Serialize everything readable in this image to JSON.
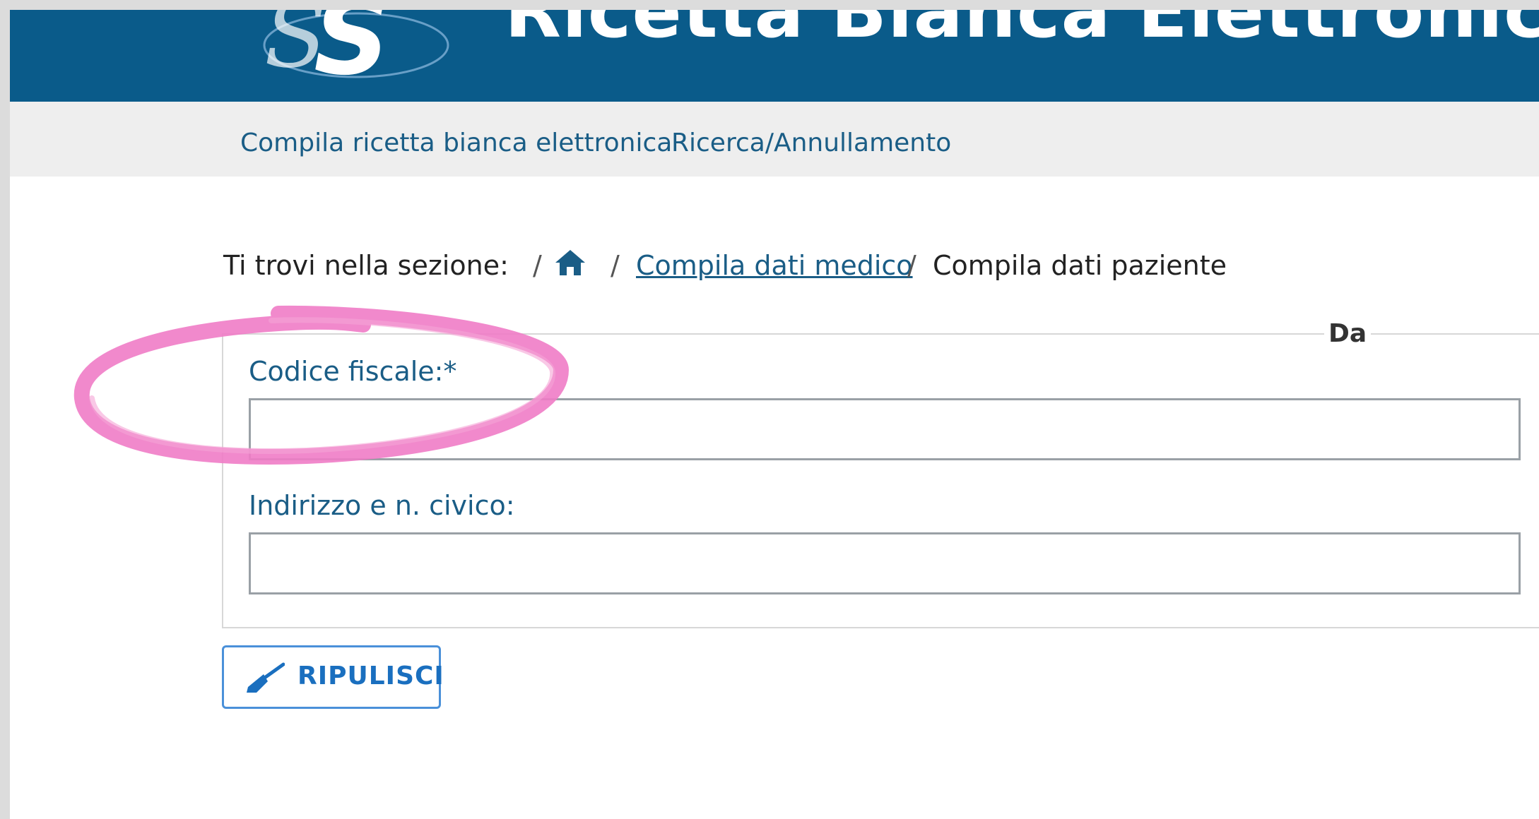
{
  "header": {
    "title": "Ricetta Bianca Elettronica",
    "logo_icon": "sts-logo-icon",
    "background_color": "#0a5b8a"
  },
  "nav": {
    "items": [
      {
        "label": "Compila ricetta bianca elettronica"
      },
      {
        "label": "Ricerca/Annullamento"
      }
    ]
  },
  "breadcrumb": {
    "prefix": "Ti trovi nella sezione:",
    "separator": "/",
    "home_icon": "home-icon",
    "items": [
      {
        "label": "Compila dati medico",
        "link": true
      },
      {
        "label": "Compila dati paziente",
        "link": false
      }
    ]
  },
  "form": {
    "legend": "Da",
    "fields": [
      {
        "label": "Codice fiscale:*",
        "value": "",
        "placeholder": ""
      },
      {
        "label": "Indirizzo e n. civico:",
        "value": "",
        "placeholder": ""
      }
    ]
  },
  "actions": {
    "clear_label": "RIPULISCI",
    "clear_icon": "broom-icon",
    "accent_color": "#1a6fbf"
  },
  "annotation": {
    "shape": "hand-drawn-circle",
    "color": "#f07cc6"
  }
}
